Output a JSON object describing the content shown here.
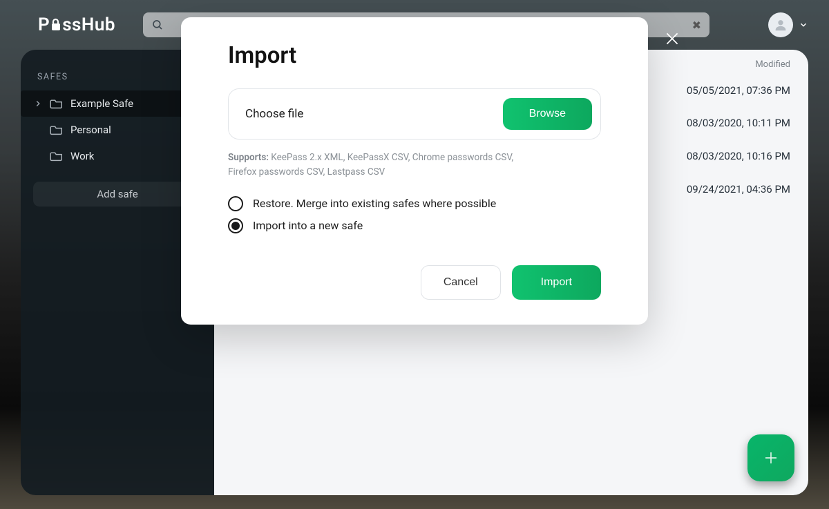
{
  "app": {
    "name": "PassHub"
  },
  "search": {
    "placeholder": "",
    "value": ""
  },
  "sidebar": {
    "heading": "SAFES",
    "items": [
      {
        "label": "Example Safe",
        "selected": true,
        "expandable": true
      },
      {
        "label": "Personal",
        "selected": false,
        "expandable": false
      },
      {
        "label": "Work",
        "selected": false,
        "expandable": false
      }
    ],
    "add_label": "Add safe"
  },
  "content": {
    "col_modified": "Modified",
    "rows": [
      {
        "modified": "05/05/2021, 07:36 PM"
      },
      {
        "modified": "08/03/2020, 10:11 PM"
      },
      {
        "modified": "08/03/2020, 10:16 PM"
      },
      {
        "modified": "09/24/2021, 04:36 PM"
      }
    ]
  },
  "modal": {
    "title": "Import",
    "file_label": "Choose file",
    "browse": "Browse",
    "supports_prefix": "Supports:",
    "supports_text": " KeePass 2.x XML, KeePassX CSV, Chrome passwords CSV, Firefox passwords CSV, Lastpass CSV",
    "options": [
      {
        "label": "Restore. Merge into existing safes where possible",
        "selected": false
      },
      {
        "label": "Import into a new safe",
        "selected": true
      }
    ],
    "cancel": "Cancel",
    "import": "Import"
  }
}
